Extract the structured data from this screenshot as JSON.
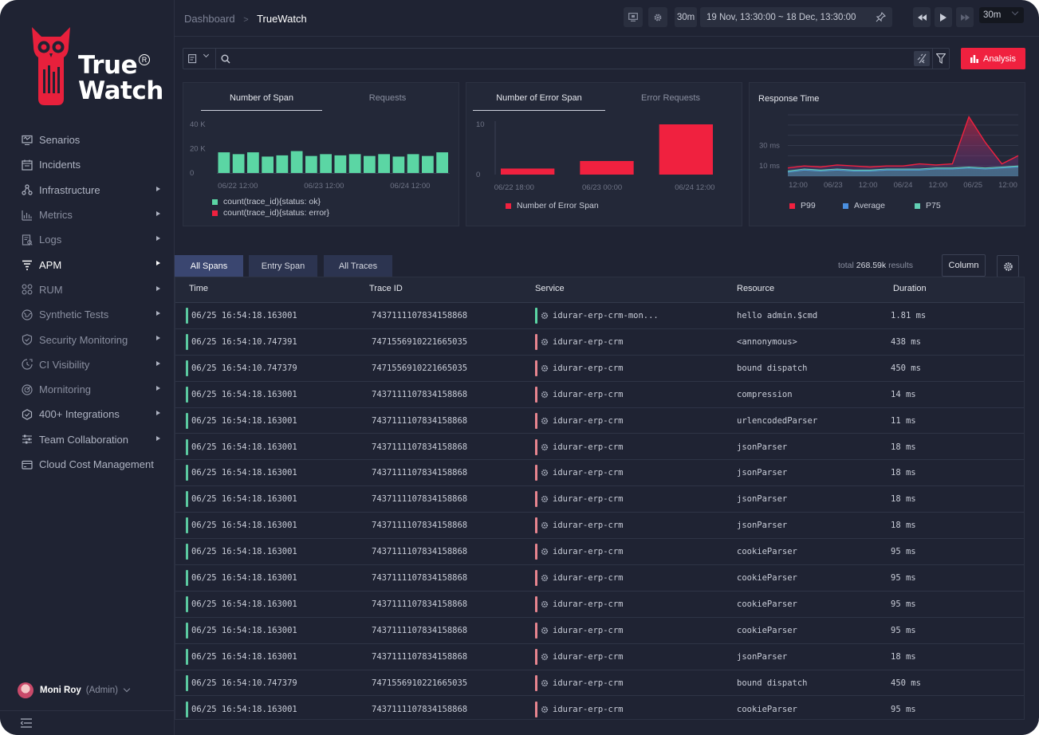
{
  "brand": {
    "line1": "True",
    "line2": "Watch",
    "reg": "R",
    "accent": "#e8203c"
  },
  "sidebar": {
    "items": [
      {
        "label": "Senarios",
        "icon": "monitor-icon",
        "arrow": false,
        "state": "normal"
      },
      {
        "label": "Incidents",
        "icon": "calendar-icon",
        "arrow": false,
        "state": "normal"
      },
      {
        "label": "Infrastructure",
        "icon": "nodes-icon",
        "arrow": true,
        "state": "normal"
      },
      {
        "label": "Metrics",
        "icon": "metrics-icon",
        "arrow": true,
        "state": "dim"
      },
      {
        "label": "Logs",
        "icon": "logs-icon",
        "arrow": true,
        "state": "dim"
      },
      {
        "label": "APM",
        "icon": "apm-icon",
        "arrow": true,
        "state": "active"
      },
      {
        "label": "RUM",
        "icon": "grid-icon",
        "arrow": true,
        "state": "dim"
      },
      {
        "label": "Synthetic Tests",
        "icon": "globe-icon",
        "arrow": true,
        "state": "dim"
      },
      {
        "label": "Security Monitoring",
        "icon": "shield-icon",
        "arrow": true,
        "state": "dim"
      },
      {
        "label": "CI Visibility",
        "icon": "ci-icon",
        "arrow": true,
        "state": "dim"
      },
      {
        "label": "Mornitoring",
        "icon": "radar-icon",
        "arrow": true,
        "state": "dim"
      },
      {
        "label": "400+ Integrations",
        "icon": "hexagon-icon",
        "arrow": true,
        "state": "normal"
      },
      {
        "label": "Team Collaboration",
        "icon": "sliders-icon",
        "arrow": true,
        "state": "normal"
      },
      {
        "label": "Cloud Cost Management",
        "icon": "card-icon",
        "arrow": false,
        "state": "normal"
      }
    ]
  },
  "user": {
    "name": "Moni Roy",
    "role": "(Admin)"
  },
  "topbar": {
    "breadcrumb_root": "Dashboard",
    "breadcrumb_sep": ">",
    "breadcrumb_current": "TrueWatch",
    "range_short": "30m",
    "time_range": "19 Nov, 13:30:00 ~ 18 Dec, 13:30:00",
    "refresh": "30m"
  },
  "search": {
    "placeholder": ""
  },
  "analysis_label": "Analysis",
  "panels": {
    "span": {
      "tab_active": "Number of Span",
      "tab_other": "Requests",
      "legend_ok": "count(trace_id){status: ok}",
      "legend_err": "count(trace_id){status: error}"
    },
    "error": {
      "tab_active": "Number of Error Span",
      "tab_other": "Error Requests",
      "legend": "Number of Error Span"
    },
    "response": {
      "title": "Response Time",
      "legend_p99": "P99",
      "legend_avg": "Average",
      "legend_p75": "P75"
    }
  },
  "colors": {
    "ok": "#5bd6a4",
    "error": "#f0213f",
    "p99": "#f0213f",
    "average": "#4a8fe0",
    "p75": "#62d0b4"
  },
  "chart_data": [
    {
      "type": "bar",
      "title": "Number of Span",
      "yticks": [
        "40 K",
        "20 K",
        "0"
      ],
      "ylim": [
        0,
        40000
      ],
      "xticks": [
        "06/22 12:00",
        "06/23 12:00",
        "06/24 12:00"
      ],
      "series": [
        {
          "name": "count(trace_id){status: ok}",
          "values": [
            17000,
            15500,
            17000,
            13500,
            14500,
            18000,
            14000,
            15500,
            14500,
            15500,
            14000,
            15500,
            13500,
            15500,
            14000,
            17000
          ]
        },
        {
          "name": "count(trace_id){status: error}",
          "values": [
            0,
            0,
            0,
            0,
            0,
            0,
            0,
            0,
            0,
            0,
            0,
            0,
            0,
            0,
            0,
            0
          ]
        }
      ]
    },
    {
      "type": "bar",
      "title": "Number of Error Span",
      "yticks": [
        "10",
        "0"
      ],
      "ylim": [
        0,
        10
      ],
      "xticks": [
        "06/22 18:00",
        "06/23 00:00",
        "06/24 12:00"
      ],
      "series": [
        {
          "name": "Number of Error Span",
          "values": [
            1.2,
            2.7,
            10
          ]
        }
      ]
    },
    {
      "type": "area",
      "title": "Response Time",
      "yticks": [
        "30 ms",
        "10 ms"
      ],
      "ylim": [
        0,
        60
      ],
      "xticks": [
        "12:00",
        "06/23",
        "12:00",
        "06/24",
        "12:00",
        "06/25",
        "12:00"
      ],
      "series": [
        {
          "name": "P99",
          "values": [
            8,
            10,
            9,
            11,
            10,
            9,
            10,
            10,
            12,
            11,
            12,
            58,
            33,
            12,
            20
          ]
        },
        {
          "name": "Average",
          "values": [
            4,
            6,
            5,
            6,
            5,
            5,
            6,
            6,
            6,
            7,
            7,
            8,
            7,
            8,
            9
          ]
        },
        {
          "name": "P75",
          "values": [
            5,
            7,
            6,
            7,
            6,
            6,
            7,
            7,
            7,
            8,
            8,
            9,
            8,
            9,
            10
          ]
        }
      ]
    }
  ],
  "span_tabs": [
    {
      "label": "All Spans",
      "active": true
    },
    {
      "label": "Entry Span",
      "active": false
    },
    {
      "label": "All Traces",
      "active": false
    }
  ],
  "results": {
    "prefix": "total",
    "count": "268.59k",
    "suffix": "results"
  },
  "column_btn": "Column",
  "table": {
    "columns": [
      "Time",
      "Trace ID",
      "Service",
      "Resource",
      "Duration"
    ],
    "rows": [
      {
        "time": "06/25 16:54:18.163001",
        "trace": "7437111107834158868",
        "service": "idurar-erp-crm-mon...",
        "svc_status": "ok",
        "resource": "hello admin.$cmd",
        "duration": "1.81 ms"
      },
      {
        "time": "06/25 16:54:10.747391",
        "trace": "7471556910221665035",
        "service": "idurar-erp-crm",
        "svc_status": "error",
        "resource": "<annonymous>",
        "duration": "438 ms"
      },
      {
        "time": "06/25 16:54:10.747379",
        "trace": "7471556910221665035",
        "service": "idurar-erp-crm",
        "svc_status": "error",
        "resource": "bound dispatch",
        "duration": "450 ms"
      },
      {
        "time": "06/25 16:54:18.163001",
        "trace": "7437111107834158868",
        "service": "idurar-erp-crm",
        "svc_status": "error",
        "resource": "compression",
        "duration": "14 ms"
      },
      {
        "time": "06/25 16:54:18.163001",
        "trace": "7437111107834158868",
        "service": "idurar-erp-crm",
        "svc_status": "error",
        "resource": "urlencodedParser",
        "duration": "11 ms"
      },
      {
        "time": "06/25 16:54:18.163001",
        "trace": "7437111107834158868",
        "service": "idurar-erp-crm",
        "svc_status": "error",
        "resource": "jsonParser",
        "duration": "18 ms"
      },
      {
        "time": "06/25 16:54:18.163001",
        "trace": "7437111107834158868",
        "service": "idurar-erp-crm",
        "svc_status": "error",
        "resource": "jsonParser",
        "duration": "18 ms"
      },
      {
        "time": "06/25 16:54:18.163001",
        "trace": "7437111107834158868",
        "service": "idurar-erp-crm",
        "svc_status": "error",
        "resource": "jsonParser",
        "duration": "18 ms"
      },
      {
        "time": "06/25 16:54:18.163001",
        "trace": "7437111107834158868",
        "service": "idurar-erp-crm",
        "svc_status": "error",
        "resource": "jsonParser",
        "duration": "18 ms"
      },
      {
        "time": "06/25 16:54:18.163001",
        "trace": "7437111107834158868",
        "service": "idurar-erp-crm",
        "svc_status": "error",
        "resource": "cookieParser",
        "duration": "95 ms"
      },
      {
        "time": "06/25 16:54:18.163001",
        "trace": "7437111107834158868",
        "service": "idurar-erp-crm",
        "svc_status": "error",
        "resource": "cookieParser",
        "duration": "95 ms"
      },
      {
        "time": "06/25 16:54:18.163001",
        "trace": "7437111107834158868",
        "service": "idurar-erp-crm",
        "svc_status": "error",
        "resource": "cookieParser",
        "duration": "95 ms"
      },
      {
        "time": "06/25 16:54:18.163001",
        "trace": "7437111107834158868",
        "service": "idurar-erp-crm",
        "svc_status": "error",
        "resource": "cookieParser",
        "duration": "95 ms"
      },
      {
        "time": "06/25 16:54:18.163001",
        "trace": "7437111107834158868",
        "service": "idurar-erp-crm",
        "svc_status": "error",
        "resource": "jsonParser",
        "duration": "18 ms"
      },
      {
        "time": "06/25 16:54:10.747379",
        "trace": "7471556910221665035",
        "service": "idurar-erp-crm",
        "svc_status": "error",
        "resource": "bound dispatch",
        "duration": "450 ms"
      },
      {
        "time": "06/25 16:54:18.163001",
        "trace": "7437111107834158868",
        "service": "idurar-erp-crm",
        "svc_status": "error",
        "resource": "cookieParser",
        "duration": "95 ms"
      }
    ]
  }
}
